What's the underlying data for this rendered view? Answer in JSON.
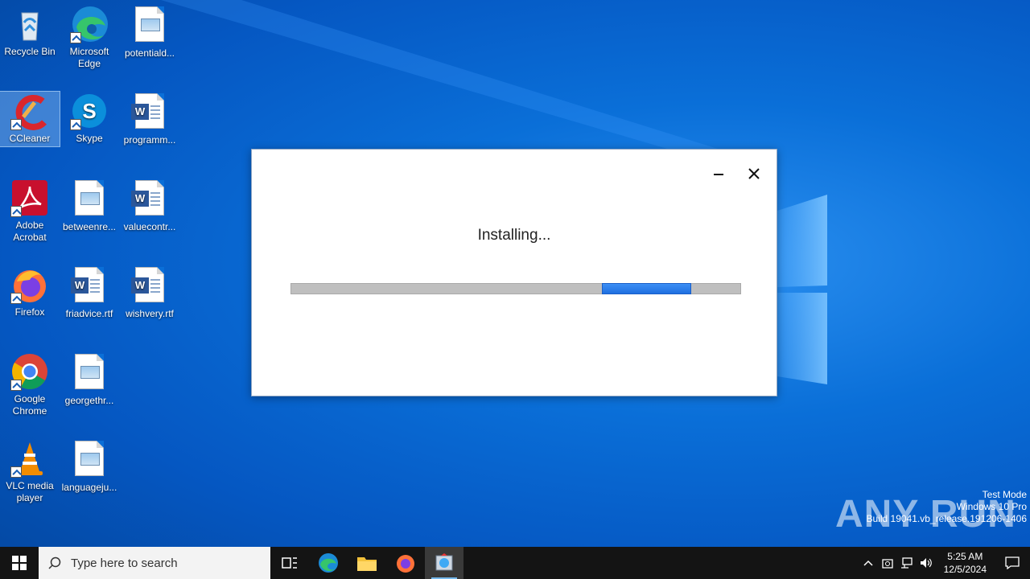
{
  "desktop": {
    "icons": [
      {
        "label": "Recycle Bin"
      },
      {
        "label": "Microsoft Edge"
      },
      {
        "label": "potentiald..."
      },
      {
        "label": "CCleaner"
      },
      {
        "label": "Skype"
      },
      {
        "label": "programm..."
      },
      {
        "label": "Adobe Acrobat"
      },
      {
        "label": "betweenre..."
      },
      {
        "label": "valuecontr..."
      },
      {
        "label": "Firefox"
      },
      {
        "label": "friadvice.rtf"
      },
      {
        "label": "wishvery.rtf"
      },
      {
        "label": "Google Chrome"
      },
      {
        "label": "georgethr..."
      },
      {
        "label": "VLC media player"
      },
      {
        "label": "languageju..."
      }
    ]
  },
  "dialog": {
    "status": "Installing...",
    "progress_indeterminate": true
  },
  "watermark": {
    "brand": "ANY RUN",
    "line1": "Test Mode",
    "line2": "Windows 10 Pro",
    "line3": "Build 19041.vb_release.191206-1406"
  },
  "taskbar": {
    "search_placeholder": "Type here to search",
    "time": "5:25 AM",
    "date": "12/5/2024"
  },
  "colors": {
    "accent": "#1f6fe0",
    "taskbar": "#141414"
  }
}
